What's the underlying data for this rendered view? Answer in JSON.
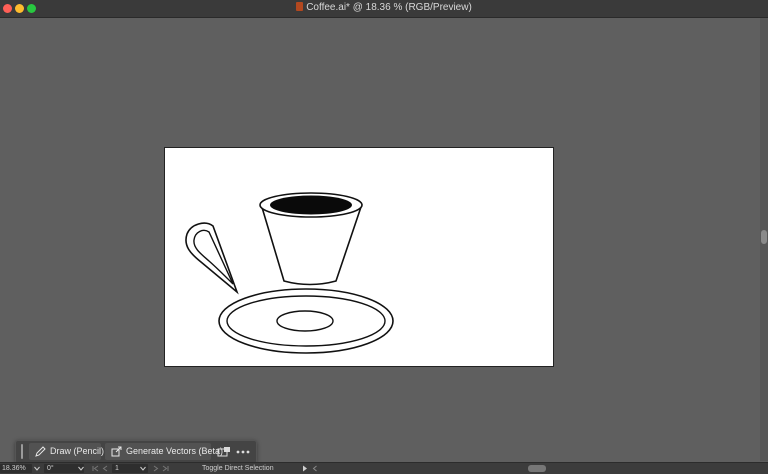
{
  "window": {
    "title": "Coffee.ai* @ 18.36 % (RGB/Preview)"
  },
  "context_toolbar": {
    "draw_label": "Draw (Pencil)",
    "generate_label": "Generate Vectors (Beta)"
  },
  "status_bar": {
    "zoom": "18.36%",
    "rotation": "0°",
    "artboard_number": "1",
    "status_text": "Toggle Direct Selection"
  },
  "colors": {
    "close": "#ff5f57",
    "minimize": "#febc2e",
    "maximize": "#28c840",
    "canvas": "#5f5f5f",
    "artboard": "#ffffff"
  },
  "artwork": {
    "subject": "coffee cup with handle and saucer, black outline drawing"
  }
}
